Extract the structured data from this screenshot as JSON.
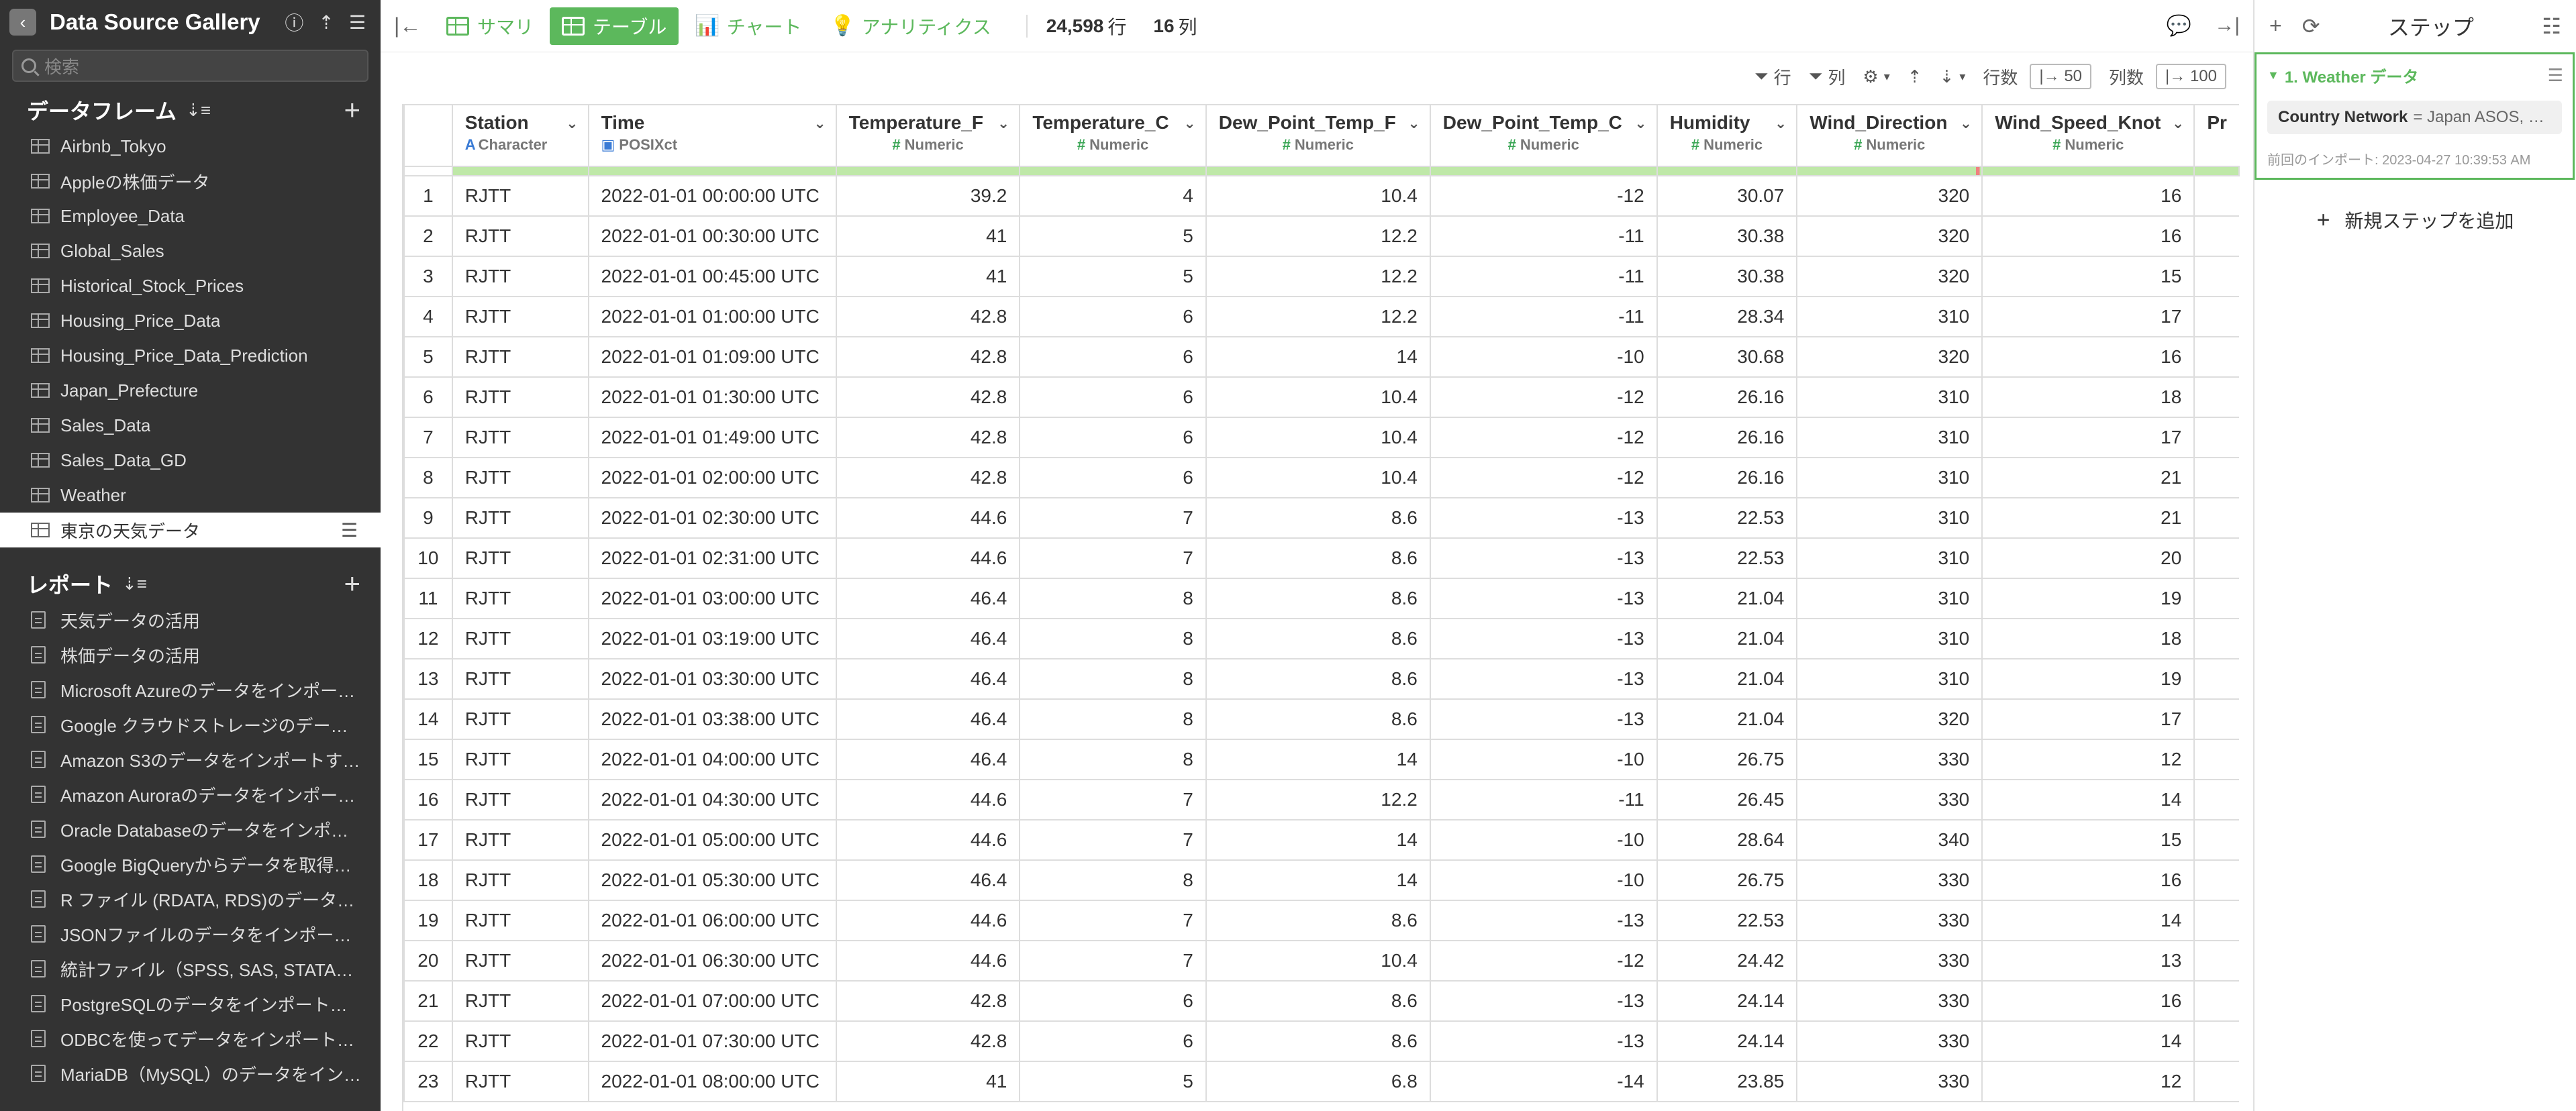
{
  "sidebar": {
    "title": "Data Source Gallery",
    "search_placeholder": "検索",
    "dataframes_title": "データフレーム",
    "dataframes": [
      "Airbnb_Tokyo",
      "Appleの株価データ",
      "Employee_Data",
      "Global_Sales",
      "Historical_Stock_Prices",
      "Housing_Price_Data",
      "Housing_Price_Data_Prediction",
      "Japan_Prefecture",
      "Sales_Data",
      "Sales_Data_GD",
      "Weather",
      "東京の天気データ"
    ],
    "active_dataframe": "東京の天気データ",
    "reports_title": "レポート",
    "reports": [
      "天気データの活用",
      "株価データの活用",
      "Microsoft Azureのデータをインポー…",
      "Google クラウドストレージのデー…",
      "Amazon S3のデータをインポートす…",
      "Amazon Auroraのデータをインポー…",
      "Oracle Databaseのデータをインポ…",
      "Google BigQueryからデータを取得…",
      "R ファイル (RDATA, RDS)のデータ…",
      "JSONファイルのデータをインポー…",
      "統計ファイル（SPSS, SAS, STATA…",
      "PostgreSQLのデータをインポート…",
      "ODBCを使ってデータをインポート…",
      "MariaDB（MySQL）のデータをイン…"
    ]
  },
  "topbar": {
    "tabs": [
      {
        "label": "サマリ",
        "active": false
      },
      {
        "label": "テーブル",
        "active": true
      },
      {
        "label": "チャート",
        "active": false
      },
      {
        "label": "アナリティクス",
        "active": false
      }
    ],
    "row_count": "24,598",
    "row_unit": "行",
    "col_count": "16",
    "col_unit": "列"
  },
  "toolbar": {
    "row_filter": "行",
    "col_filter": "列",
    "rows_label": "行数",
    "rows_value": "|→ 50",
    "cols_label": "列数",
    "cols_value": "|→ 100"
  },
  "table": {
    "columns": [
      {
        "name": "Station",
        "type": "Character",
        "kind": "char"
      },
      {
        "name": "Time",
        "type": "POSIXct",
        "kind": "date"
      },
      {
        "name": "Temperature_F",
        "type": "Numeric",
        "kind": "num"
      },
      {
        "name": "Temperature_C",
        "type": "Numeric",
        "kind": "num"
      },
      {
        "name": "Dew_Point_Temp_F",
        "type": "Numeric",
        "kind": "num"
      },
      {
        "name": "Dew_Point_Temp_C",
        "type": "Numeric",
        "kind": "num"
      },
      {
        "name": "Humidity",
        "type": "Numeric",
        "kind": "num"
      },
      {
        "name": "Wind_Direction",
        "type": "Numeric",
        "kind": "num"
      },
      {
        "name": "Wind_Speed_Knot",
        "type": "Numeric",
        "kind": "num"
      },
      {
        "name": "Pr",
        "type": "",
        "kind": "cut"
      }
    ],
    "rows": [
      [
        "1",
        "RJTT",
        "2022-01-01 00:00:00 UTC",
        "39.2",
        "4",
        "10.4",
        "-12",
        "30.07",
        "320",
        "16"
      ],
      [
        "2",
        "RJTT",
        "2022-01-01 00:30:00 UTC",
        "41",
        "5",
        "12.2",
        "-11",
        "30.38",
        "320",
        "16"
      ],
      [
        "3",
        "RJTT",
        "2022-01-01 00:45:00 UTC",
        "41",
        "5",
        "12.2",
        "-11",
        "30.38",
        "320",
        "15"
      ],
      [
        "4",
        "RJTT",
        "2022-01-01 01:00:00 UTC",
        "42.8",
        "6",
        "12.2",
        "-11",
        "28.34",
        "310",
        "17"
      ],
      [
        "5",
        "RJTT",
        "2022-01-01 01:09:00 UTC",
        "42.8",
        "6",
        "14",
        "-10",
        "30.68",
        "320",
        "16"
      ],
      [
        "6",
        "RJTT",
        "2022-01-01 01:30:00 UTC",
        "42.8",
        "6",
        "10.4",
        "-12",
        "26.16",
        "310",
        "18"
      ],
      [
        "7",
        "RJTT",
        "2022-01-01 01:49:00 UTC",
        "42.8",
        "6",
        "10.4",
        "-12",
        "26.16",
        "310",
        "17"
      ],
      [
        "8",
        "RJTT",
        "2022-01-01 02:00:00 UTC",
        "42.8",
        "6",
        "10.4",
        "-12",
        "26.16",
        "310",
        "21"
      ],
      [
        "9",
        "RJTT",
        "2022-01-01 02:30:00 UTC",
        "44.6",
        "7",
        "8.6",
        "-13",
        "22.53",
        "310",
        "21"
      ],
      [
        "10",
        "RJTT",
        "2022-01-01 02:31:00 UTC",
        "44.6",
        "7",
        "8.6",
        "-13",
        "22.53",
        "310",
        "20"
      ],
      [
        "11",
        "RJTT",
        "2022-01-01 03:00:00 UTC",
        "46.4",
        "8",
        "8.6",
        "-13",
        "21.04",
        "310",
        "19"
      ],
      [
        "12",
        "RJTT",
        "2022-01-01 03:19:00 UTC",
        "46.4",
        "8",
        "8.6",
        "-13",
        "21.04",
        "310",
        "18"
      ],
      [
        "13",
        "RJTT",
        "2022-01-01 03:30:00 UTC",
        "46.4",
        "8",
        "8.6",
        "-13",
        "21.04",
        "310",
        "19"
      ],
      [
        "14",
        "RJTT",
        "2022-01-01 03:38:00 UTC",
        "46.4",
        "8",
        "8.6",
        "-13",
        "21.04",
        "320",
        "17"
      ],
      [
        "15",
        "RJTT",
        "2022-01-01 04:00:00 UTC",
        "46.4",
        "8",
        "14",
        "-10",
        "26.75",
        "330",
        "12"
      ],
      [
        "16",
        "RJTT",
        "2022-01-01 04:30:00 UTC",
        "44.6",
        "7",
        "12.2",
        "-11",
        "26.45",
        "330",
        "14"
      ],
      [
        "17",
        "RJTT",
        "2022-01-01 05:00:00 UTC",
        "44.6",
        "7",
        "14",
        "-10",
        "28.64",
        "340",
        "15"
      ],
      [
        "18",
        "RJTT",
        "2022-01-01 05:30:00 UTC",
        "46.4",
        "8",
        "14",
        "-10",
        "26.75",
        "330",
        "16"
      ],
      [
        "19",
        "RJTT",
        "2022-01-01 06:00:00 UTC",
        "44.6",
        "7",
        "8.6",
        "-13",
        "22.53",
        "330",
        "14"
      ],
      [
        "20",
        "RJTT",
        "2022-01-01 06:30:00 UTC",
        "44.6",
        "7",
        "10.4",
        "-12",
        "24.42",
        "330",
        "13"
      ],
      [
        "21",
        "RJTT",
        "2022-01-01 07:00:00 UTC",
        "42.8",
        "6",
        "8.6",
        "-13",
        "24.14",
        "330",
        "16"
      ],
      [
        "22",
        "RJTT",
        "2022-01-01 07:30:00 UTC",
        "42.8",
        "6",
        "8.6",
        "-13",
        "24.14",
        "330",
        "14"
      ],
      [
        "23",
        "RJTT",
        "2022-01-01 08:00:00 UTC",
        "41",
        "5",
        "6.8",
        "-14",
        "23.85",
        "330",
        "12"
      ]
    ]
  },
  "steps_panel": {
    "title": "ステップ",
    "step_title": "1. Weather データ",
    "param_key": "Country Network",
    "param_value": "= Japan ASOS, …",
    "last_import": "前回のインポート: 2023-04-27 10:39:53 AM",
    "add_step": "新規ステップを追加"
  },
  "colors": {
    "accent": "#5cb85c",
    "sidebar_bg": "#333333"
  }
}
